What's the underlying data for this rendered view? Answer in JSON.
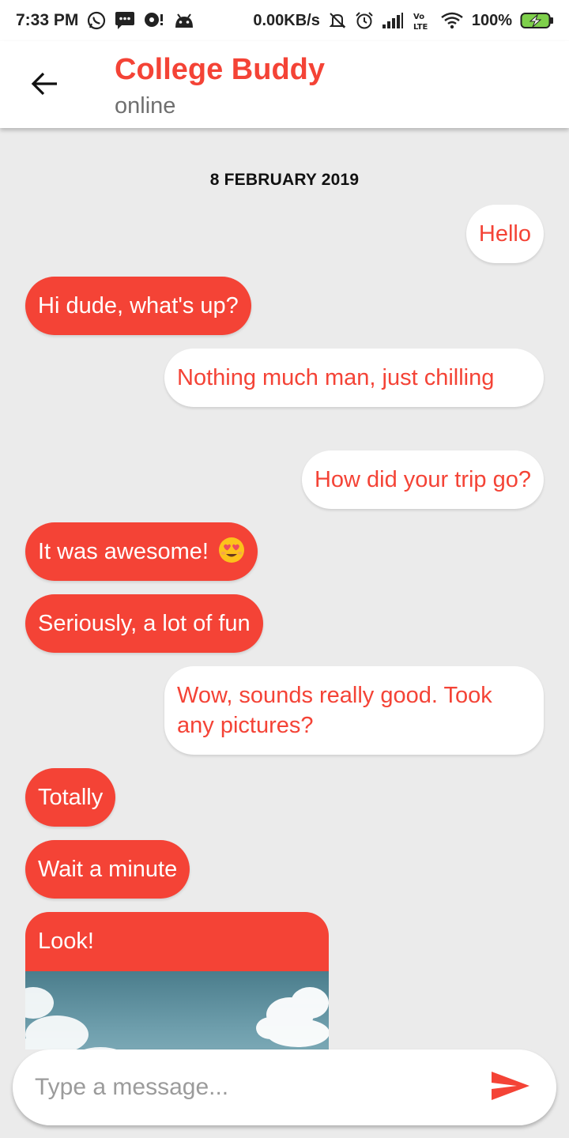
{
  "status_bar": {
    "time": "7:33 PM",
    "network_speed": "0.00KB/s",
    "battery": "100%",
    "icons": [
      "whatsapp-icon",
      "sms-icon",
      "chat-icon",
      "android-icon",
      "mute-icon",
      "alarm-icon",
      "signal-icon",
      "volte-icon",
      "wifi-icon",
      "battery-charging-icon"
    ]
  },
  "header": {
    "title": "College Buddy",
    "subtitle": "online",
    "back_icon": "arrow-back-icon"
  },
  "chat": {
    "date": "8 FEBRUARY 2019",
    "messages": [
      {
        "side": "out",
        "text": "Hello"
      },
      {
        "side": "in",
        "text": "Hi dude, what's up?"
      },
      {
        "side": "out",
        "text": "Nothing much man, just chilling"
      },
      {
        "side": "out",
        "text": "How did your trip go?"
      },
      {
        "side": "in",
        "text": "It was awesome!",
        "emoji": "heart-eyes-emoji"
      },
      {
        "side": "in",
        "text": "Seriously, a lot of fun"
      },
      {
        "side": "out",
        "text": "Wow, sounds really good. Took any pictures?"
      },
      {
        "side": "in",
        "text": "Totally"
      },
      {
        "side": "in",
        "text": "Wait a minute"
      },
      {
        "side": "in",
        "text": "Look!",
        "image": "sky-clouds-photo"
      }
    ]
  },
  "composer": {
    "placeholder": "Type a message...",
    "send_icon": "send-icon"
  },
  "colors": {
    "accent": "#f44336",
    "background": "#ebebeb",
    "bubble_out": "#ffffff",
    "bubble_in": "#f44336"
  }
}
